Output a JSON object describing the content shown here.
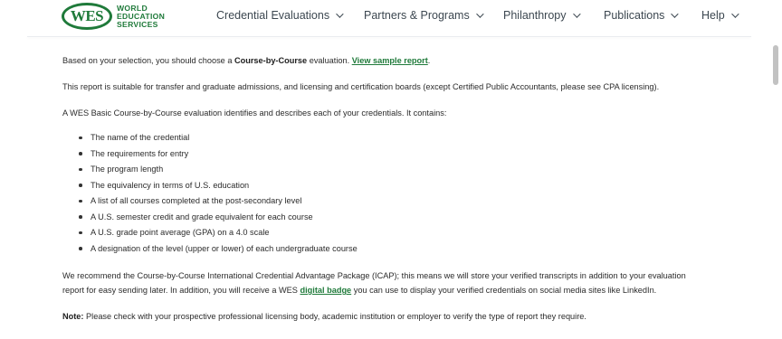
{
  "logo": {
    "mark": "WES",
    "line1": "WORLD",
    "line2": "EDUCATION",
    "line3": "SERVICES"
  },
  "nav": [
    {
      "label": "Credential Evaluations"
    },
    {
      "label": "Partners & Programs"
    },
    {
      "label": "Philanthropy"
    },
    {
      "label": "Publications"
    },
    {
      "label": "Help"
    }
  ],
  "content": {
    "p1_pre": "Based on your selection, you should choose a ",
    "p1_bold": "Course-by-Course",
    "p1_mid": " evaluation. ",
    "p1_link": "View sample report",
    "p1_end": ".",
    "p2": "This report is suitable for transfer and graduate admissions, and licensing and certification boards (except Certified Public Accountants, please see CPA licensing).",
    "p3": "A WES Basic Course-by-Course evaluation identifies and describes each of your credentials. It contains:",
    "bullets": [
      "The name of the credential",
      "The requirements for entry",
      "The program length",
      "The equivalency in terms of U.S. education",
      "A list of all courses completed at the post-secondary level",
      "A U.S. semester credit and grade equivalent for each course",
      "A U.S. grade point average (GPA) on a 4.0 scale",
      "A designation of the level (upper or lower) of each undergraduate course"
    ],
    "p4_line1": "We recommend the Course-by-Course International Credential Advantage Package (ICAP); this means we will store your verified transcripts in addition to your evaluation",
    "p4_line2_pre": "report for easy sending later. In addition, you will receive a WES ",
    "p4_link": "digital badge",
    "p4_line2_post": " you can use to display your verified credentials on social media sites like LinkedIn.",
    "note_label": "Note:",
    "note_text": " Please check with your prospective professional licensing body, academic institution or employer to verify the type of report they require."
  },
  "colors": {
    "brand_green": "#1f7a3a",
    "nav_text": "#3c4750",
    "body_text": "#2b2b2b"
  }
}
